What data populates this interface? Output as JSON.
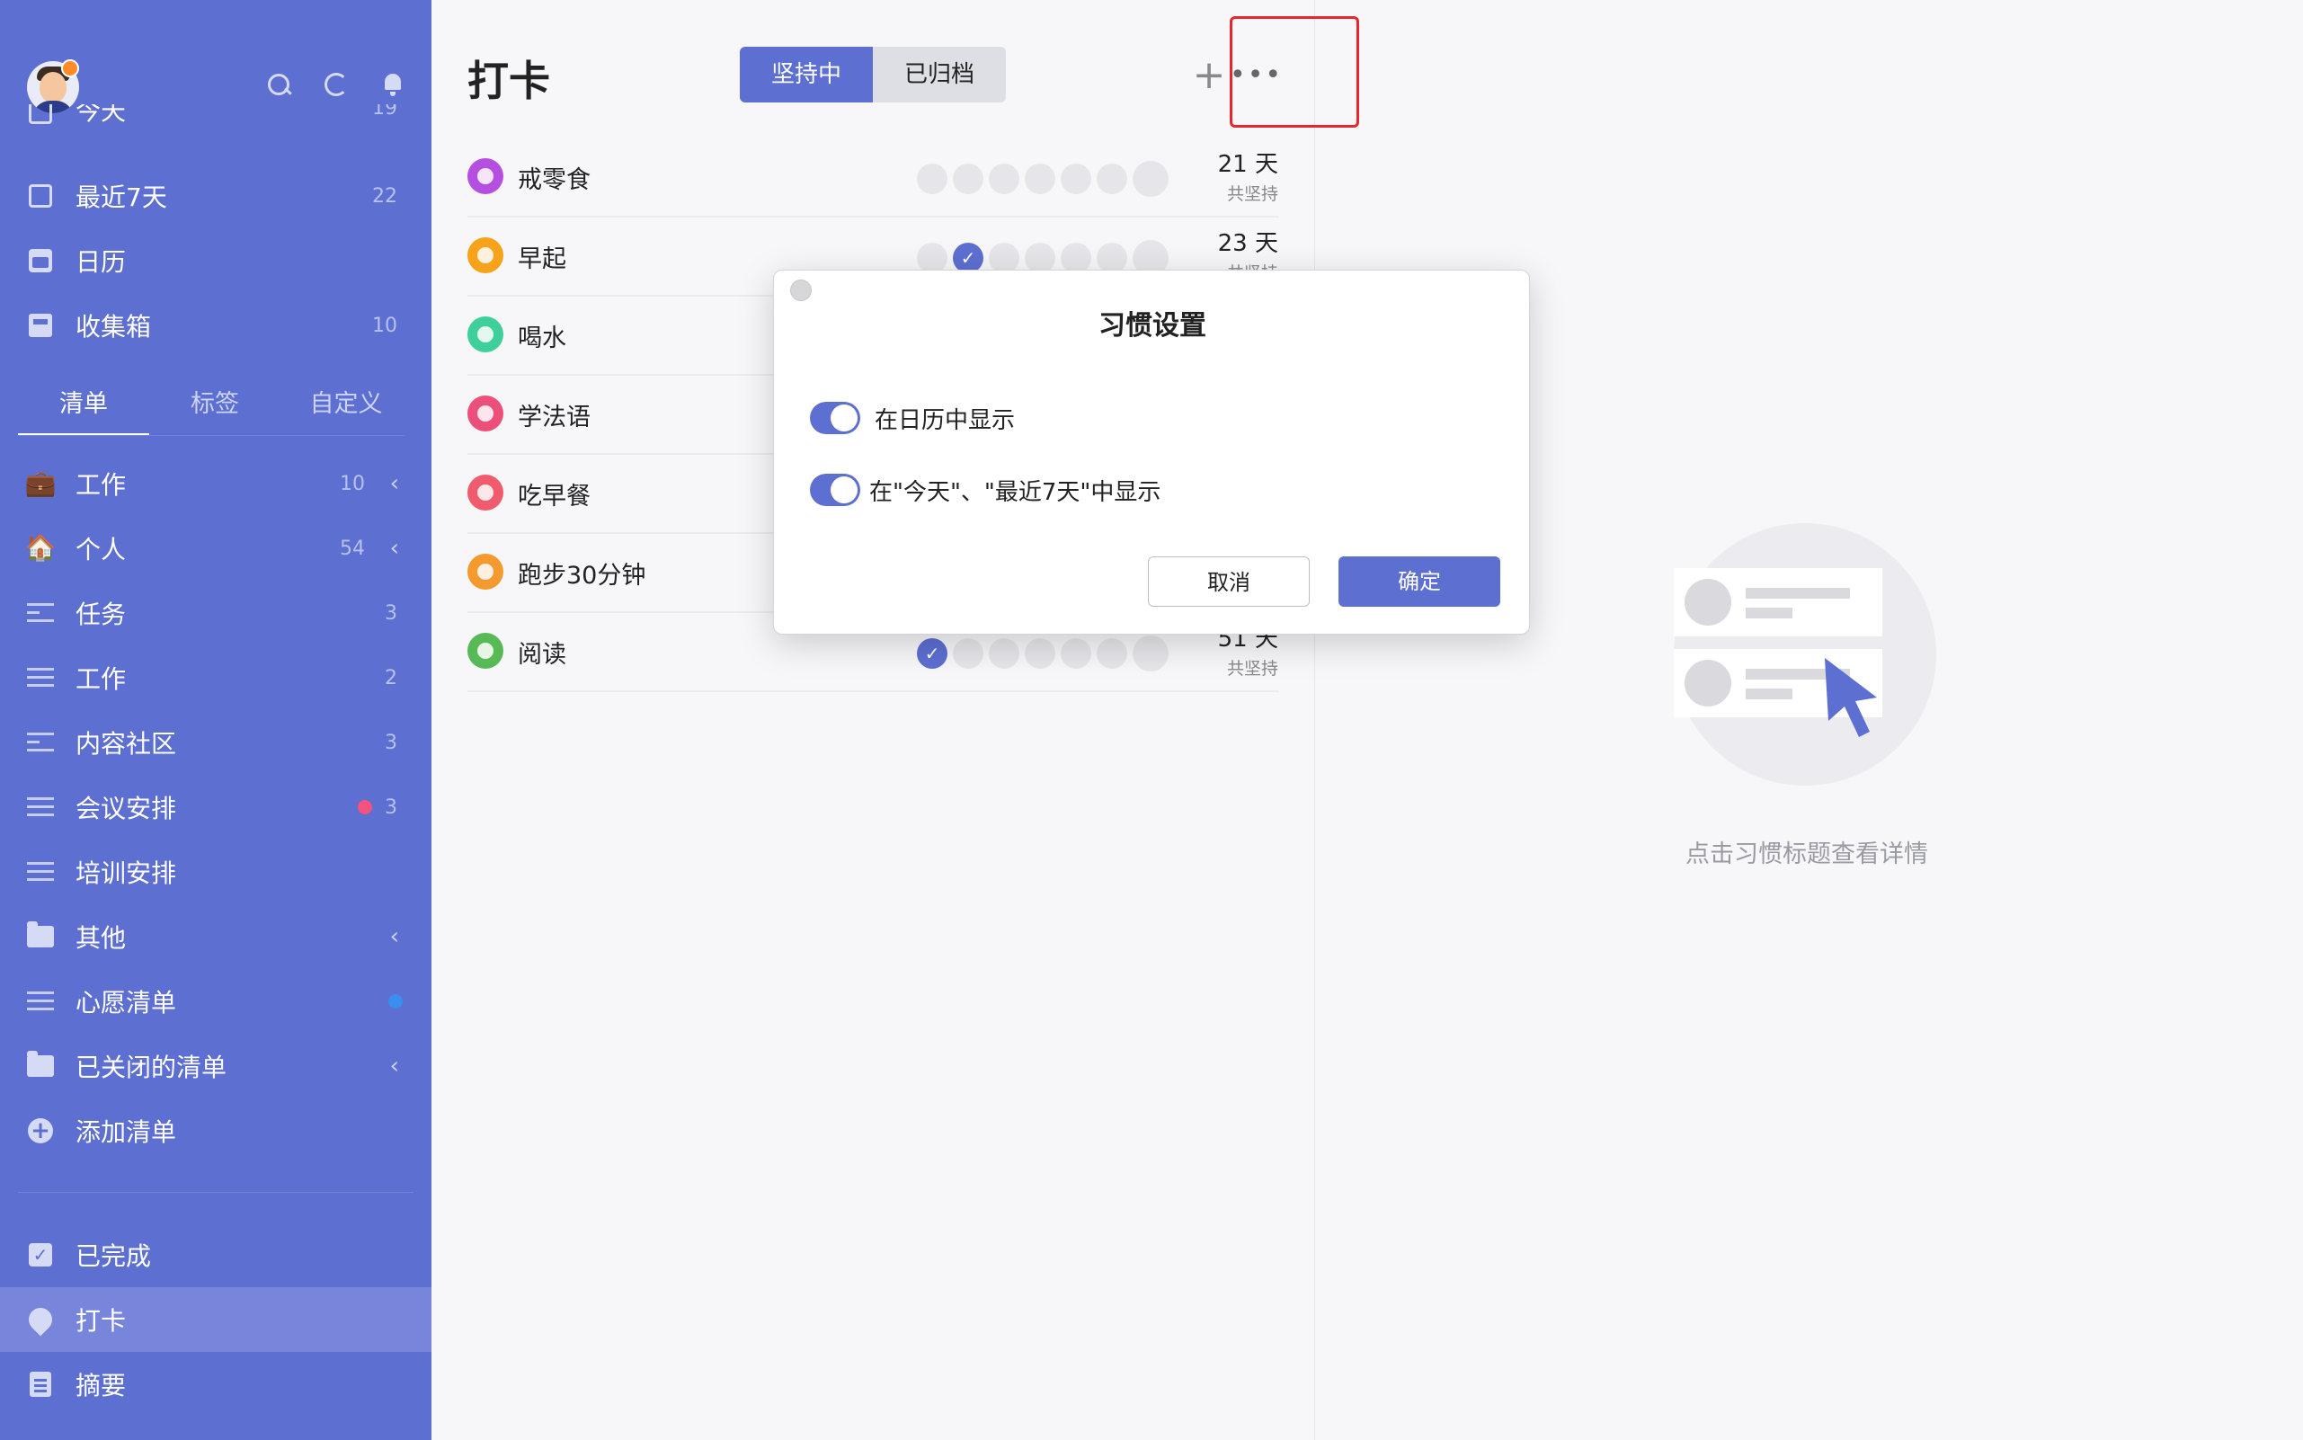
{
  "sidebar": {
    "smart_lists": [
      {
        "label": "今天",
        "count": "19"
      },
      {
        "label": "最近7天",
        "count": "22"
      },
      {
        "label": "日历",
        "count": ""
      },
      {
        "label": "收集箱",
        "count": "10"
      }
    ],
    "tabs": [
      "清单",
      "标签",
      "自定义"
    ],
    "lists": [
      {
        "label": "工作",
        "count": "10",
        "icon": "briefcase-icon"
      },
      {
        "label": "个人",
        "count": "54",
        "icon": "house-icon"
      },
      {
        "label": "任务",
        "count": "3",
        "icon": "people-icon"
      },
      {
        "label": "工作",
        "count": "2",
        "icon": "lines-icon"
      },
      {
        "label": "内容社区",
        "count": "3",
        "icon": "people-icon"
      },
      {
        "label": "会议安排",
        "count": "3",
        "icon": "lines-icon",
        "dot_color": "#f2547d"
      },
      {
        "label": "培训安排",
        "count": "",
        "icon": "lines-icon"
      },
      {
        "label": "其他",
        "count": "",
        "icon": "folder-icon"
      },
      {
        "label": "心愿清单",
        "count": "",
        "icon": "lines-icon",
        "dot_color": "#3a8ef0"
      },
      {
        "label": "已关闭的清单",
        "count": "",
        "icon": "archive-icon"
      },
      {
        "label": "添加清单",
        "count": "",
        "icon": "plus-circle-icon"
      }
    ],
    "bottom": [
      {
        "label": "已完成"
      },
      {
        "label": "打卡"
      },
      {
        "label": "摘要"
      }
    ]
  },
  "main": {
    "title": "打卡",
    "segments": [
      "坚持中",
      "已归档"
    ],
    "habits": [
      {
        "name": "戒零食",
        "color": "#b44fe0",
        "days_num": "21 天",
        "days_sub": "共坚持",
        "checked_index": -1
      },
      {
        "name": "早起",
        "color": "#f7a21b",
        "days_num": "23 天",
        "days_sub": "共坚持",
        "checked_index": 1
      },
      {
        "name": "喝水",
        "color": "#3fcf9a",
        "days_num": "",
        "days_sub": "",
        "checked_index": -1
      },
      {
        "name": "学法语",
        "color": "#ec4f7a",
        "days_num": "",
        "days_sub": "",
        "checked_index": -1
      },
      {
        "name": "吃早餐",
        "color": "#f05c6e",
        "days_num": "",
        "days_sub": "",
        "checked_index": -1
      },
      {
        "name": "跑步30分钟",
        "color": "#f59a2f",
        "days_num": "",
        "days_sub": "",
        "checked_index": -1
      },
      {
        "name": "阅读",
        "color": "#58b957",
        "days_num": "51 天",
        "days_sub": "共坚持",
        "checked_index": 0
      }
    ]
  },
  "detail": {
    "hint": "点击习惯标题查看详情"
  },
  "dialog": {
    "title": "习惯设置",
    "options": [
      "在日历中显示",
      "在\"今天\"、\"最近7天\"中显示"
    ],
    "cancel": "取消",
    "confirm": "确定"
  },
  "colors": {
    "accent": "#5d6fd1",
    "highlight": "#e8262b"
  }
}
